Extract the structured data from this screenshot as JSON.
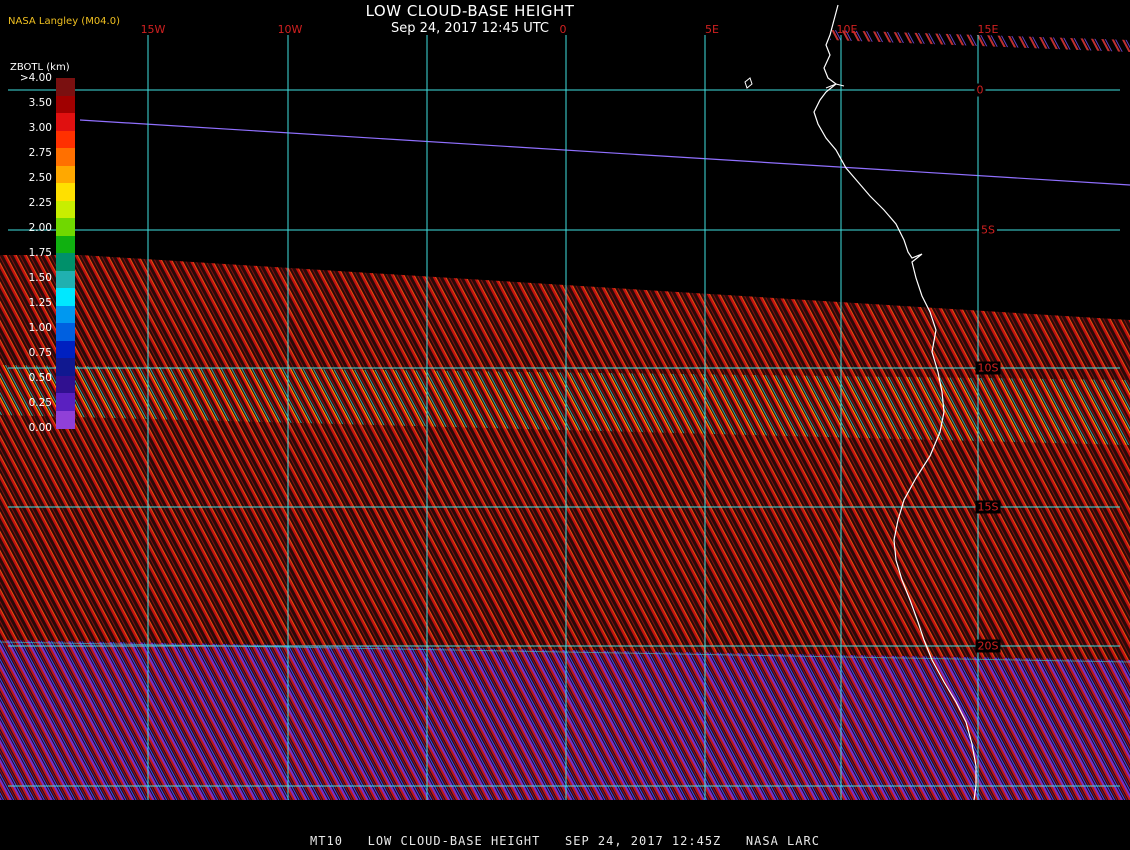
{
  "header": {
    "title": "LOW CLOUD-BASE HEIGHT",
    "datetime": "Sep 24, 2017 12:45 UTC",
    "agency": "NASA Langley (M04.0)"
  },
  "footer": {
    "text": "MT10   LOW CLOUD-BASE HEIGHT   SEP 24, 2017 12:45Z   NASA LARC"
  },
  "map": {
    "longitude_labels": [
      "15W",
      "10W",
      "0",
      "5E",
      "10E",
      "15E"
    ],
    "latitude_labels": [
      "0",
      "5S",
      "10S",
      "15S",
      "20S"
    ],
    "grid_color": "#40e0e0",
    "coastline_color": "#ffffff",
    "label_color": "#d02020"
  },
  "legend": {
    "title": "ZBOTL (km)",
    "ticks": [
      ">4.00",
      "3.50",
      "3.00",
      "2.75",
      "2.50",
      "2.25",
      "2.00",
      "1.75",
      "1.50",
      "1.25",
      "1.00",
      "0.75",
      "0.50",
      "0.25",
      "0.00"
    ],
    "colors": [
      "#7a1010",
      "#a00000",
      "#e01010",
      "#ff3000",
      "#ff7000",
      "#ffa800",
      "#ffe000",
      "#c8ee00",
      "#70d800",
      "#10b010",
      "#00906a",
      "#20b0b0",
      "#00e8ff",
      "#0098f0",
      "#0060e0",
      "#0020c0",
      "#101890",
      "#301090",
      "#5a20c0",
      "#9040d8"
    ]
  }
}
